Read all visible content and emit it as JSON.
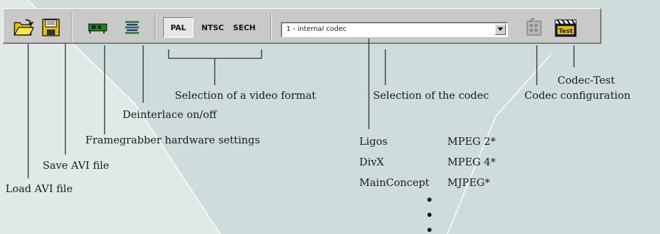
{
  "toolbar": {
    "format_buttons": [
      "PAL",
      "NTSC",
      "SECH"
    ],
    "codec_select_value": "1 - internal codec",
    "test_icon_text": "Test"
  },
  "annotations": {
    "load_avi": "Load AVI file",
    "save_avi": "Save AVI file",
    "framegrabber": "Framegrabber hardware settings",
    "deinterlace": "Deinterlace on/off",
    "video_format": "Selection of a video format",
    "codec_selection": "Selection of the codec",
    "codec_test": "Codec-Test",
    "codec_config": "Codec configuration"
  },
  "codec_list": [
    {
      "vendor": "Ligos",
      "format": "MPEG 2*"
    },
    {
      "vendor": "DivX",
      "format": "MPEG 4*"
    },
    {
      "vendor": "MainConcept",
      "format": "MJPEG*"
    }
  ]
}
